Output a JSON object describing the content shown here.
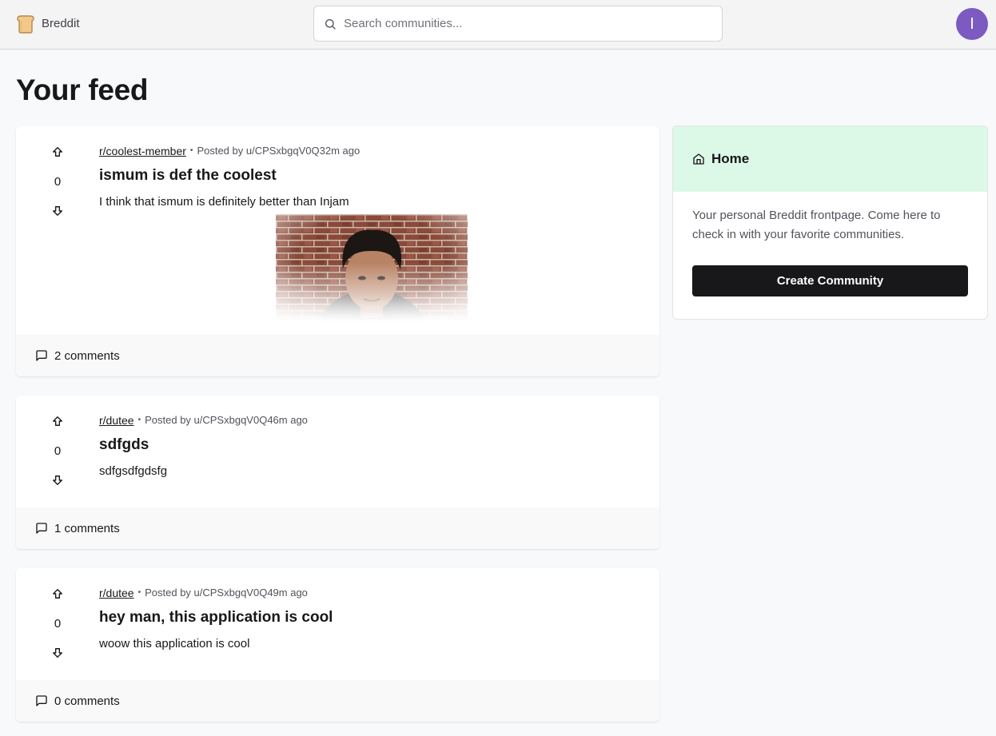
{
  "navbar": {
    "brand_name": "Breddit",
    "search_placeholder": "Search communities...",
    "avatar_initial": "I"
  },
  "page": {
    "title": "Your feed"
  },
  "posts": [
    {
      "subreddit": "r/coolest-member",
      "posted_by": "Posted by u/CPSxbgqV0Q",
      "time_ago": "32m ago",
      "title": "ismum is def the coolest",
      "text": "I think that ismum is definitely better than Injam",
      "votes": "0",
      "comments": "2 comments",
      "has_image": true
    },
    {
      "subreddit": "r/dutee",
      "posted_by": "Posted by u/CPSxbgqV0Q",
      "time_ago": "46m ago",
      "title": "sdfgds",
      "text": "sdfgsdfgdsfg",
      "votes": "0",
      "comments": "1 comments",
      "has_image": false
    },
    {
      "subreddit": "r/dutee",
      "posted_by": "Posted by u/CPSxbgqV0Q",
      "time_ago": "49m ago",
      "title": "hey man, this application is cool",
      "text": "woow this application is cool",
      "votes": "0",
      "comments": "0 comments",
      "has_image": false
    }
  ],
  "sidebar": {
    "header": "Home",
    "description": "Your personal Breddit frontpage. Come here to check in with your favorite communities.",
    "create_button": "Create Community"
  },
  "colors": {
    "avatar": "#7c5ac2",
    "sidebar_header_bg": "#dcf8e6",
    "primary_button": "#18181b"
  },
  "icons": {
    "brand": "bread-logo-icon",
    "search": "search-icon",
    "upvote": "arrow-up-icon",
    "downvote": "arrow-down-icon",
    "comments": "message-square-icon",
    "home": "home-icon"
  }
}
